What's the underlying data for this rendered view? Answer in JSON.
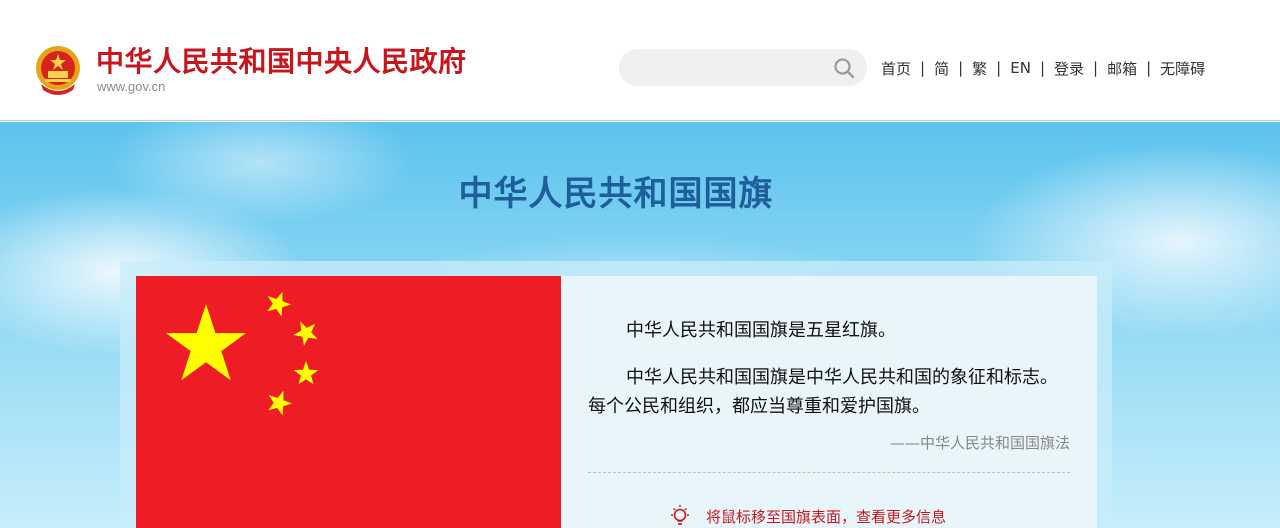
{
  "header": {
    "site_title": "中华人民共和国中央人民政府",
    "site_url": "www.gov.cn",
    "search": {
      "placeholder": "",
      "icon": "search-icon"
    },
    "nav": [
      "首页",
      "简",
      "繁",
      "EN",
      "登录",
      "邮箱",
      "无障碍"
    ],
    "separator": "|"
  },
  "banner": {
    "heading": "中华人民共和国国旗",
    "text": {
      "p1": "中华人民共和国国旗是五星红旗。",
      "p2": "中华人民共和国国旗是中华人民共和国的象征和标志。每个公民和组织，都应当尊重和爱护国旗。",
      "source": "——中华人民共和国国旗法"
    },
    "hint": "将鼠标移至国旗表面，查看更多信息"
  },
  "colors": {
    "brand_red": "#c8161d",
    "heading_blue": "#1d5e9b",
    "flag_red": "#ee1c25",
    "flag_star": "#ffff00"
  }
}
